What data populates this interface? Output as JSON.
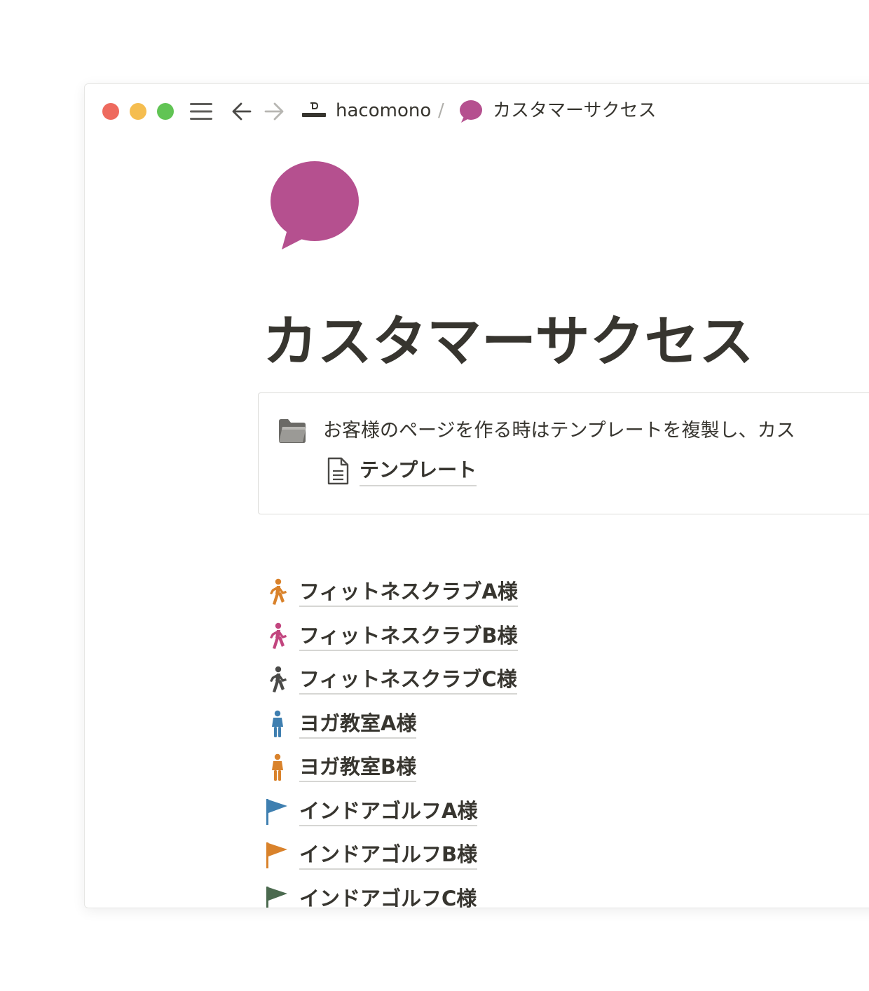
{
  "window": {
    "breadcrumb": {
      "workspace": "hacomono",
      "separator": "/",
      "page": "カスタマーサクセス"
    }
  },
  "page": {
    "icon": "speech-bubble-icon",
    "title": "カスタマーサクセス",
    "callout": {
      "icon": "folder-icon",
      "text": "お客様のページを作る時はテンプレートを複製し、カス",
      "link": {
        "icon": "document-icon",
        "label": "テンプレート"
      }
    },
    "customers": [
      {
        "label": "フィットネスクラブA様",
        "icon": "runner-icon",
        "color": "#d9822b"
      },
      {
        "label": "フィットネスクラブB様",
        "icon": "runner-icon",
        "color": "#c2457f"
      },
      {
        "label": "フィットネスクラブC様",
        "icon": "runner-icon",
        "color": "#4a4a48"
      },
      {
        "label": "ヨガ教室A様",
        "icon": "person-icon",
        "color": "#3f7fb0"
      },
      {
        "label": "ヨガ教室B様",
        "icon": "person-icon",
        "color": "#d9822b"
      },
      {
        "label": "インドアゴルフA様",
        "icon": "flag-icon",
        "color": "#3f7fb0"
      },
      {
        "label": "インドアゴルフB様",
        "icon": "flag-icon",
        "color": "#d9822b"
      },
      {
        "label": "インドアゴルフC様",
        "icon": "flag-icon",
        "color": "#4b6a4f"
      }
    ]
  },
  "colors": {
    "text": "#37352f",
    "accent_bubble": "#b5508f",
    "traffic_red": "#ee6a5e",
    "traffic_yellow": "#f5bd4f",
    "traffic_green": "#61c454"
  }
}
